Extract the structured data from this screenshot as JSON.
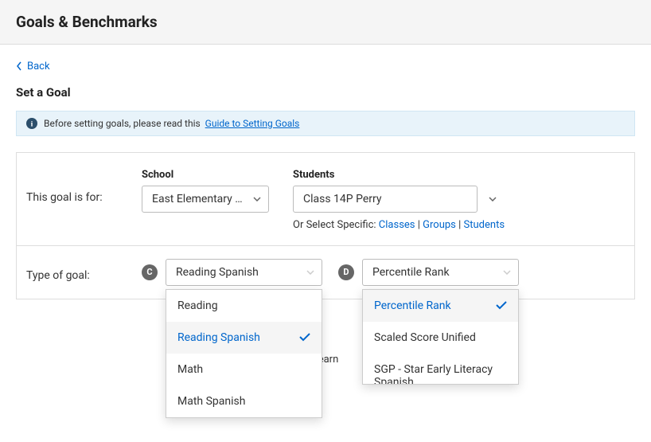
{
  "header": {
    "title": "Goals & Benchmarks"
  },
  "back": {
    "label": "Back"
  },
  "subtitle": "Set a Goal",
  "info": {
    "text": "Before setting goals, please read this",
    "link": "Guide to Setting Goals"
  },
  "goalFor": {
    "label": "This goal is for:",
    "school": {
      "label": "School",
      "value": "East Elementary Sch…"
    },
    "students": {
      "label": "Students",
      "value": "Class 14P Perry",
      "sub": {
        "prefix": "Or Select Specific:",
        "classes": "Classes",
        "groups": "Groups",
        "students": "Students"
      }
    }
  },
  "typeOfGoal": {
    "label": "Type of goal:",
    "badgeC": "C",
    "badgeD": "D",
    "selectType": {
      "value": "Reading Spanish",
      "options": [
        {
          "label": "Reading",
          "selected": false
        },
        {
          "label": "Reading Spanish",
          "selected": true
        },
        {
          "label": "Math",
          "selected": false
        },
        {
          "label": "Math Spanish",
          "selected": false
        }
      ]
    },
    "selectMetric": {
      "value": "Percentile Rank",
      "options": [
        {
          "label": "Percentile Rank",
          "selected": true
        },
        {
          "label": "Scaled Score Unified",
          "selected": false
        },
        {
          "label": "SGP - Star Early Literacy Spanish",
          "selected": false
        }
      ]
    }
  },
  "learn": "Learn"
}
